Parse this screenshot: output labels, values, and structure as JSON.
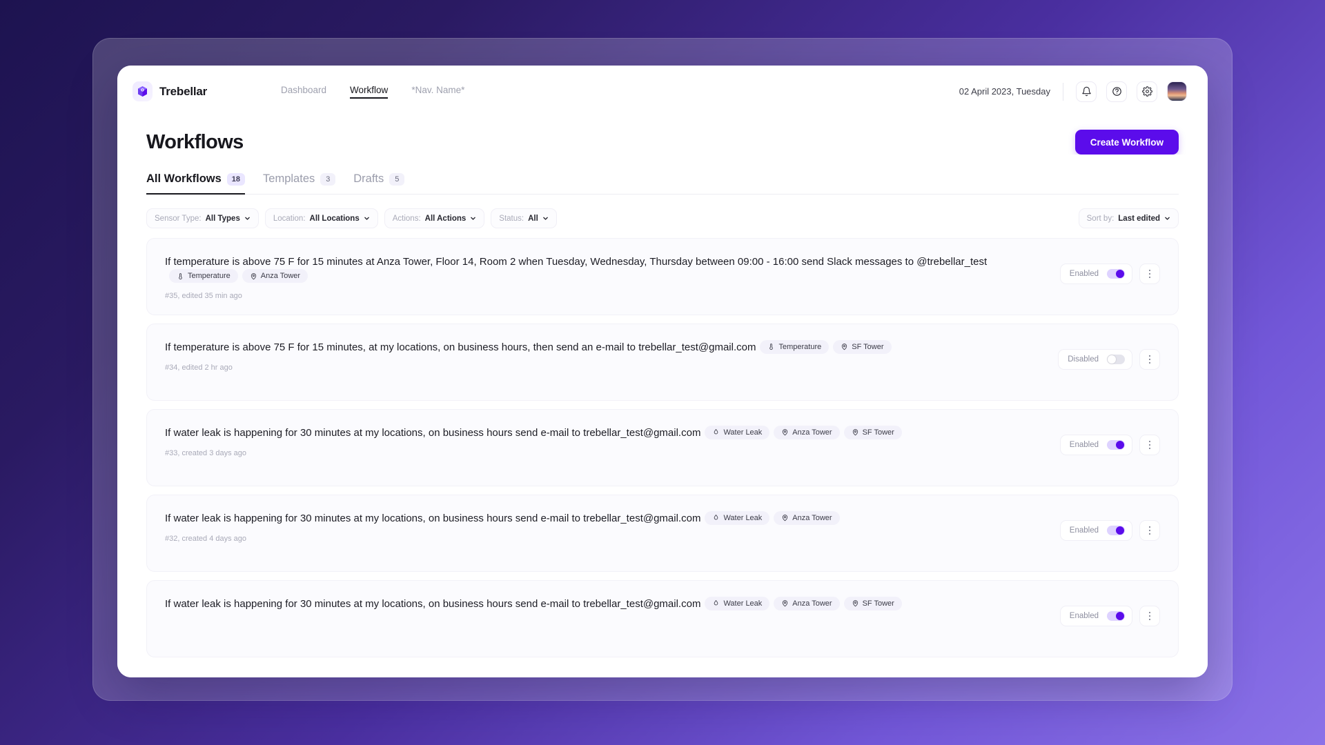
{
  "brand": {
    "name": "Trebellar",
    "logo_icon": "cube-logo-icon"
  },
  "nav": {
    "items": [
      {
        "label": "Dashboard",
        "active": false
      },
      {
        "label": "Workflow",
        "active": true
      },
      {
        "label": "*Nav. Name*",
        "active": false
      }
    ]
  },
  "topbar": {
    "date": "02 April 2023, Tuesday",
    "icons": [
      {
        "name": "bell-icon"
      },
      {
        "name": "help-circle-icon"
      },
      {
        "name": "gear-icon"
      }
    ],
    "avatar_name": "user-avatar"
  },
  "page": {
    "title": "Workflows",
    "create_button": "Create Workflow"
  },
  "tabs": [
    {
      "label": "All Workflows",
      "count": "18",
      "active": true
    },
    {
      "label": "Templates",
      "count": "3",
      "active": false
    },
    {
      "label": "Drafts",
      "count": "5",
      "active": false
    }
  ],
  "filters": [
    {
      "name": "sensor-type",
      "label": "Sensor Type:",
      "value": "All Types"
    },
    {
      "name": "location",
      "label": "Location:",
      "value": "All Locations"
    },
    {
      "name": "actions",
      "label": "Actions:",
      "value": "All Actions"
    },
    {
      "name": "status",
      "label": "Status:",
      "value": "All"
    }
  ],
  "sort": {
    "label": "Sort by:",
    "value": "Last edited"
  },
  "workflows": [
    {
      "text": "If temperature is above 75 F for 15 minutes at Anza Tower, Floor 14, Room 2 when Tuesday, Wednesday, Thursday between 09:00 - 16:00 send Slack messages to @trebellar_test",
      "tags": [
        {
          "icon": "thermometer-icon",
          "label": "Temperature"
        },
        {
          "icon": "map-pin-icon",
          "label": "Anza Tower"
        }
      ],
      "meta": "#35, edited 35 min ago",
      "status_label": "Enabled",
      "enabled": true
    },
    {
      "text": "If temperature is above 75 F for 15 minutes, at my locations, on business hours, then send an e-mail to trebellar_test@gmail.com",
      "tags": [
        {
          "icon": "thermometer-icon",
          "label": "Temperature"
        },
        {
          "icon": "map-pin-icon",
          "label": "SF Tower"
        }
      ],
      "meta": "#34, edited 2 hr ago",
      "status_label": "Disabled",
      "enabled": false
    },
    {
      "text": "If water leak is happening for 30 minutes at my locations, on business hours send e-mail to trebellar_test@gmail.com",
      "tags": [
        {
          "icon": "water-drop-icon",
          "label": "Water Leak"
        },
        {
          "icon": "map-pin-icon",
          "label": "Anza Tower"
        },
        {
          "icon": "map-pin-icon",
          "label": "SF Tower"
        }
      ],
      "meta": "#33, created 3 days ago",
      "status_label": "Enabled",
      "enabled": true
    },
    {
      "text": "If water leak is happening for 30 minutes at my locations, on business hours send e-mail to trebellar_test@gmail.com",
      "tags": [
        {
          "icon": "water-drop-icon",
          "label": "Water Leak"
        },
        {
          "icon": "map-pin-icon",
          "label": "Anza Tower"
        }
      ],
      "meta": "#32, created 4 days ago",
      "status_label": "Enabled",
      "enabled": true
    },
    {
      "text": "If water leak is happening for 30 minutes at my locations, on business hours send e-mail to trebellar_test@gmail.com",
      "tags": [
        {
          "icon": "water-drop-icon",
          "label": "Water Leak"
        },
        {
          "icon": "map-pin-icon",
          "label": "Anza Tower"
        },
        {
          "icon": "map-pin-icon",
          "label": "SF Tower"
        }
      ],
      "meta": "",
      "status_label": "Enabled",
      "enabled": true
    }
  ],
  "colors": {
    "accent": "#5b0ceb",
    "bg_gradient_start": "#1d1350",
    "bg_gradient_end": "#8b72e8",
    "text_primary": "#17171d",
    "text_muted": "#a9aab8"
  }
}
